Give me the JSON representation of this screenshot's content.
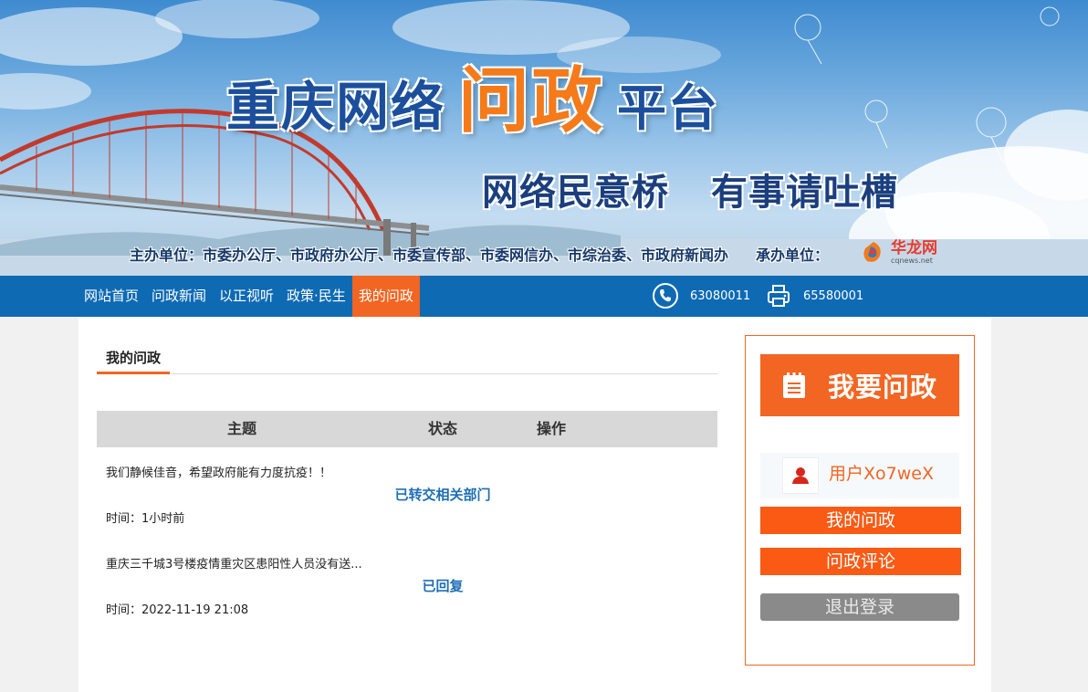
{
  "banner": {
    "title_part1": "重庆网络",
    "title_highlight": "问政",
    "title_part2": "平台",
    "slogan_1": "网络民意桥",
    "slogan_2": "有事请吐槽",
    "sponsor_text": "主办单位：市委办公厅、市政府办公厅、市委宣传部、市委网信办、市综治委、市政府新闻办",
    "host_label": "承办单位：",
    "host_logo_cn": "华龙网",
    "host_logo_en": "cqnews.net"
  },
  "nav": {
    "items": [
      "网站首页",
      "问政新闻",
      "以正视听",
      "政策·民生",
      "我的问政"
    ],
    "active_index": 4,
    "phone": "63080011",
    "fax": "65580001"
  },
  "main": {
    "tab": "我的问政",
    "headers": {
      "subject": "主题",
      "status": "状态",
      "action": "操作"
    },
    "rows": [
      {
        "subject": "我们静候佳音，希望政府能有力度抗疫！！",
        "status": "已转交相关部门",
        "time": "时间：1小时前"
      },
      {
        "subject": "重庆三千城3号楼疫情重灾区患阳性人员没有送...",
        "status": "已回复",
        "time": "时间：2022-11-19 21:08"
      }
    ]
  },
  "sidebar": {
    "ask_label": "我要问政",
    "username": "用户Xo7weX",
    "my_questions": "我的问政",
    "comments": "问政评论",
    "logout": "退出登录"
  },
  "colors": {
    "nav_blue": "#0e6ab3",
    "accent_orange": "#f26522",
    "status_blue": "#1e6fb4"
  }
}
